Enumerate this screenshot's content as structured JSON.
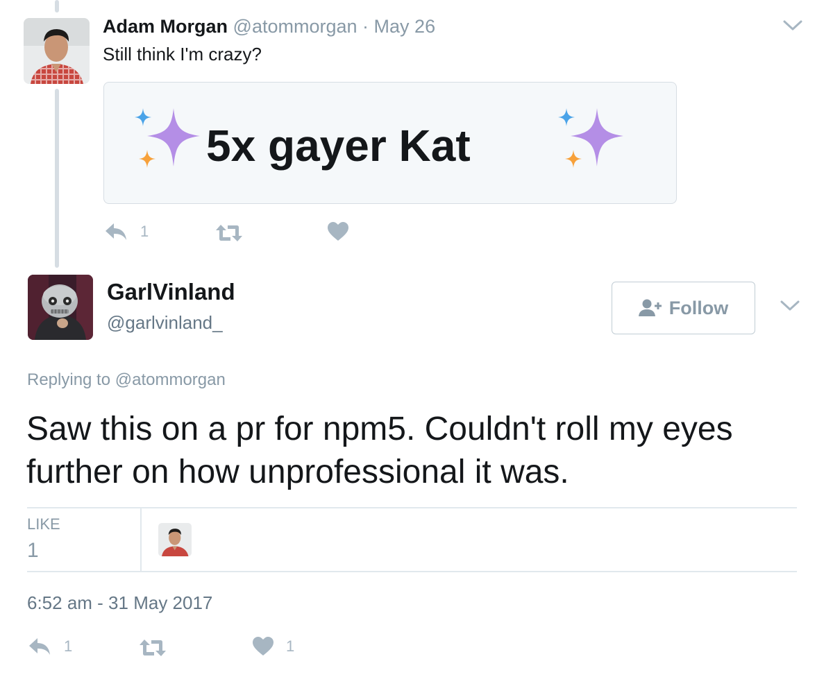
{
  "tweet1": {
    "name": "Adam Morgan",
    "handle": "@atommorgan",
    "separator": "·",
    "date": "May 26",
    "text": "Still think I'm crazy?",
    "card_text": "5x gayer Kat",
    "reply_count": "1",
    "retweet_count": "",
    "like_count": ""
  },
  "tweet2": {
    "name": "GarlVinland",
    "handle": "@garlvinland_",
    "follow_label": "Follow",
    "replying_prefix": "Replying to",
    "replying_handle": "@atommorgan",
    "text": "Saw this on a pr for npm5. Couldn't roll my eyes further on how unprofessional it was.",
    "like_label": "LIKE",
    "like_total": "1",
    "timestamp": "6:52 am - 31 May 2017",
    "reply_count": "1",
    "retweet_count": "",
    "like_count": "1"
  },
  "icons": {
    "reply": "reply-icon",
    "retweet": "retweet-icon",
    "like": "heart-icon",
    "caret": "chevron-down-icon",
    "follow": "add-user-icon",
    "sparkles": "sparkles-icon"
  },
  "colors": {
    "icon_gray": "#a7b6c2",
    "sparkle_purple": "#b48ee6",
    "sparkle_blue": "#4aa3e8",
    "sparkle_orange": "#f7a13a"
  }
}
